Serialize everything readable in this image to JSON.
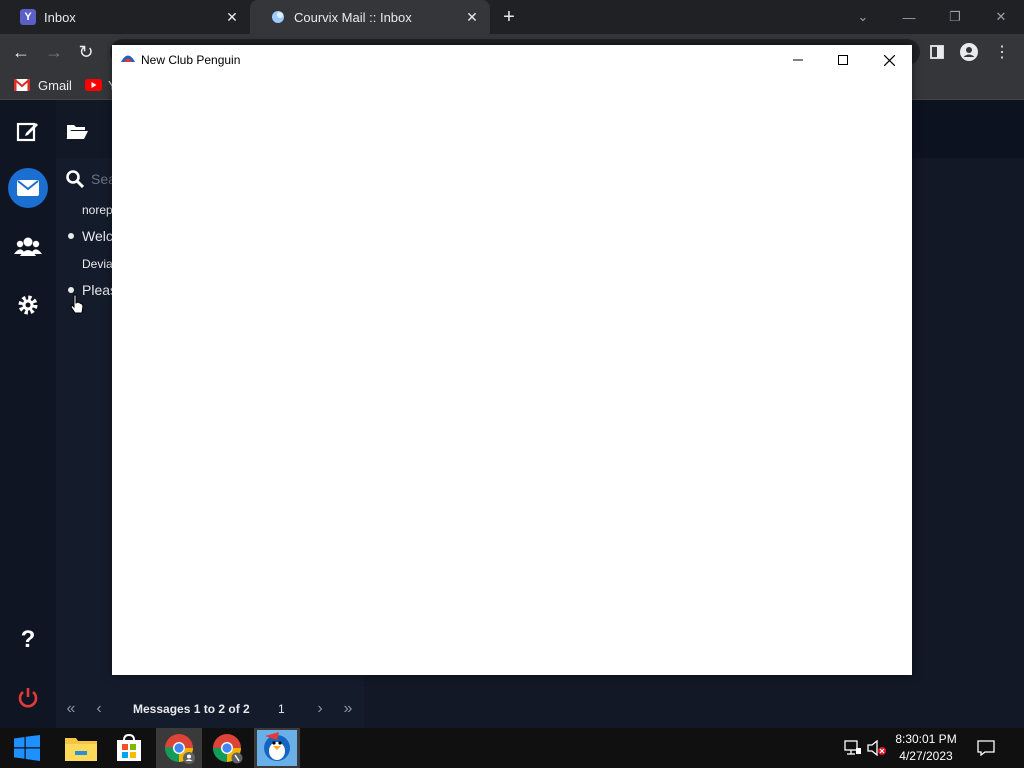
{
  "browser": {
    "tabs": [
      {
        "title": "Inbox",
        "favicon": "Y",
        "active": false
      },
      {
        "title": "Courvix Mail :: Inbox",
        "favicon": "courvix-logo",
        "active": true
      }
    ],
    "bookmarks": [
      {
        "label": "Gmail",
        "icon": "gmail-icon"
      },
      {
        "label": "Y",
        "icon": "youtube-icon"
      }
    ]
  },
  "webmail": {
    "search": {
      "placeholder": "Sea"
    },
    "messages": [
      {
        "sender": "norep",
        "subject": "Welc"
      },
      {
        "sender": "Devia",
        "subject": "Pleas"
      }
    ],
    "pager": {
      "summary": "Messages 1 to 2 of 2",
      "page": "1"
    }
  },
  "popup": {
    "title": "New Club Penguin"
  },
  "taskbar": {
    "clock_time": "8:30:01 PM",
    "clock_date": "4/27/2023"
  },
  "colors": {
    "accent": "#1a6fd1",
    "power": "#e53935"
  }
}
